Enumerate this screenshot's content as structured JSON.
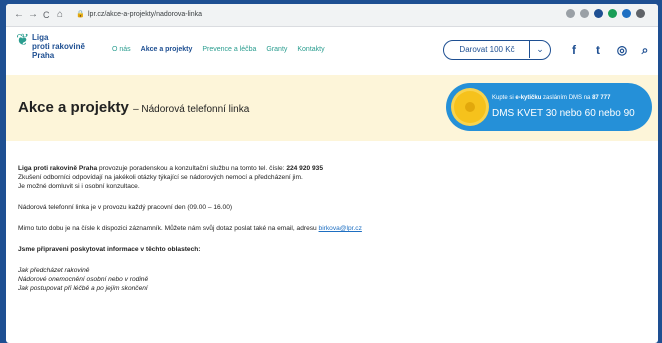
{
  "browser": {
    "nav_back": "←",
    "nav_forward": "→",
    "nav_reload": "C",
    "nav_home": "⌂",
    "url": "lpr.cz/akce-a-projekty/nadorova-linka"
  },
  "header": {
    "logo_lines": [
      "Liga",
      "proti rakovině",
      "Praha"
    ],
    "menu": [
      {
        "label": "O nás",
        "active": false
      },
      {
        "label": "Akce a projekty",
        "active": true
      },
      {
        "label": "Prevence a léčba",
        "active": false
      },
      {
        "label": "Granty",
        "active": false
      },
      {
        "label": "Kontakty",
        "active": false
      }
    ],
    "donate_label": "Darovat 100 Kč",
    "donate_chevron": "⌄",
    "social": {
      "facebook": "f",
      "twitter": "t",
      "instagram": "◎",
      "search": "⌕"
    }
  },
  "hero": {
    "title": "Akce a projekty",
    "subtitle": "– Nádorová telefonní linka"
  },
  "dms": {
    "line1_pre": "Kupte si",
    "line1_bold1": "e-kytičku",
    "line1_mid": "zasláním DMS na",
    "line1_bold2": "87 777",
    "line2": "DMS KVET 30 nebo 60 nebo 90"
  },
  "content": {
    "p1_bold": "Liga proti rakovině Praha",
    "p1_text": "provozuje poradenskou a konzultační službu na tomto tel. čísle:",
    "p1_phone": "224 920 935",
    "p1_line2": "Zkušení odborníci odpovídají na jakékoli otázky týkající se nádorových nemocí a předcházení jim.",
    "p1_line3": "Je možné domluvit si i osobní konzultace.",
    "p2": "Nádorová telefonní linka je v provozu každý pracovní den (09.00 – 16.00)",
    "p3": "Mimo tuto dobu je na čísle k dispozici záznamník. Můžete nám svůj dotaz poslat také na email, adresu",
    "email": "birkova@lpr.cz",
    "p4": "Jsme připraveni poskytovat informace v těchto oblastech:",
    "topics": [
      "Jak předcházet rakovině",
      "Nádorové onemocnění osobní nebo v rodině",
      "Jak postupovat při léčbě a po jejím skončení"
    ]
  }
}
